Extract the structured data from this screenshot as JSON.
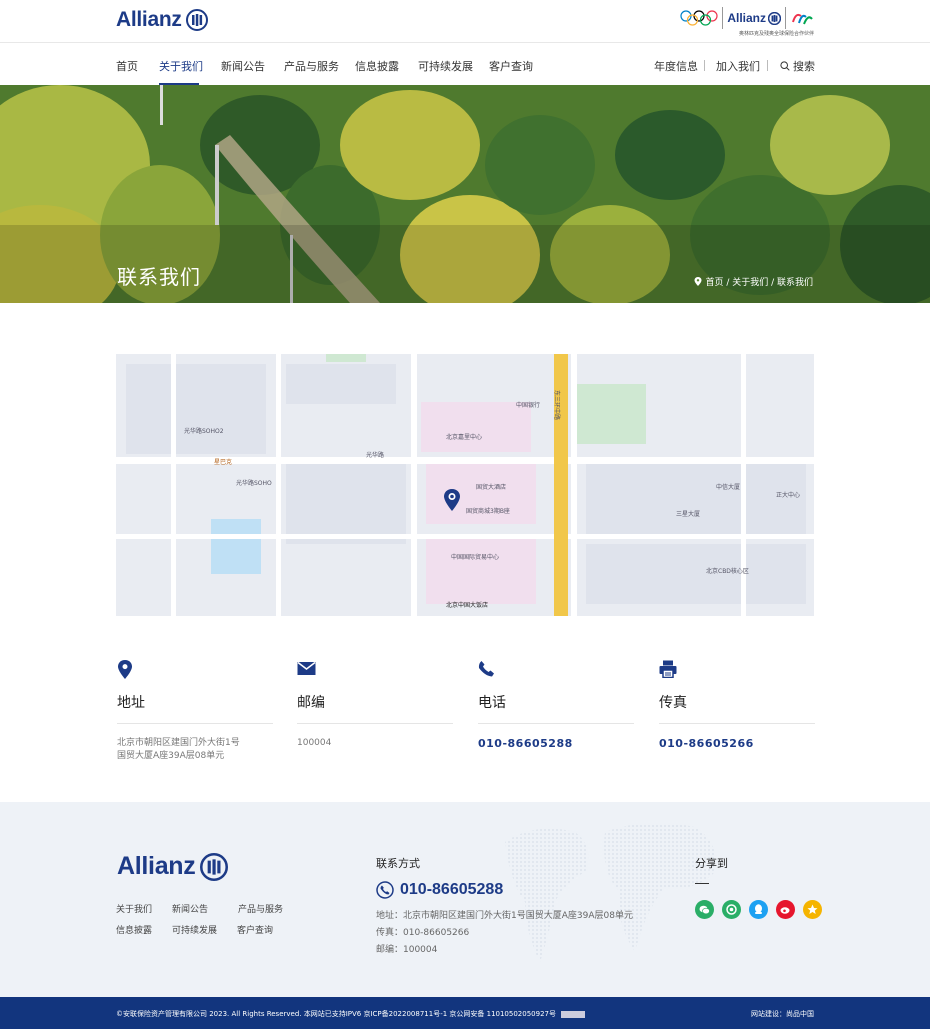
{
  "brand": {
    "name": "Allianz",
    "partner_name": "Allianz",
    "partner_text": "奥林匹克及残奥全球保险合作伙伴"
  },
  "nav": {
    "items": [
      {
        "label": "首页"
      },
      {
        "label": "关于我们",
        "active": true
      },
      {
        "label": "新闻公告"
      },
      {
        "label": "产品与服务"
      },
      {
        "label": "信息披露"
      },
      {
        "label": "可持续发展"
      },
      {
        "label": "客户查询"
      }
    ],
    "right": [
      {
        "label": "年度信息"
      },
      {
        "label": "加入我们"
      },
      {
        "label": "搜索"
      }
    ]
  },
  "banner": {
    "title": "联系我们",
    "breadcrumb": "首页 / 关于我们 / 联系我们"
  },
  "map": {
    "labels": [
      "光华路",
      "光华路SOHO",
      "北京嘉里中心",
      "国贸大酒店",
      "中国银行",
      "东三环中路",
      "光华路SOHO2",
      "星巴克",
      "北京中国大饭店",
      "正大中心",
      "中信大厦",
      "三星大厦",
      "北京CBD核心区",
      "国贸商城3期B座",
      "中国国际贸易中心"
    ]
  },
  "contact_cards": [
    {
      "icon": "location-icon",
      "title": "地址",
      "value_line1": "北京市朝阳区建国门外大街1号",
      "value_line2": "国贸大厦A座39A层08单元"
    },
    {
      "icon": "mail-icon",
      "title": "邮编",
      "value_line1": "100004",
      "value_line2": ""
    },
    {
      "icon": "phone-icon",
      "title": "电话",
      "value_line1": "010-86605288",
      "value_line2": ""
    },
    {
      "icon": "fax-icon",
      "title": "传真",
      "value_line1": "010-86605266",
      "value_line2": ""
    }
  ],
  "footer": {
    "logo_text": "Allianz",
    "links": [
      "关于我们",
      "新闻公告",
      "产品与服务",
      "信息披露",
      "可持续发展",
      "客户查询"
    ],
    "contact_heading": "联系方式",
    "phone": "010-86605288",
    "address": "地址：北京市朝阳区建国门外大街1号国贸大厦A座39A层08单元",
    "fax": "传真：010-86605266",
    "postcode": "邮编：100004",
    "share_heading": "分享到",
    "share_icons": [
      {
        "name": "wechat-icon",
        "color": "#2aae67"
      },
      {
        "name": "moments-icon",
        "color": "#2aae67"
      },
      {
        "name": "qq-icon",
        "color": "#1da1f2"
      },
      {
        "name": "weibo-icon",
        "color": "#e6162d"
      },
      {
        "name": "favorite-icon",
        "color": "#f5b400"
      }
    ]
  },
  "bottom": {
    "copyright": "©安联保险资产管理有限公司 2023. All Rights Reserved. 本网站已支持IPV6  京ICP备2022008711号-1  京公网安备 11010502050927号",
    "builder": "网站建设：尚品中国"
  },
  "colors": {
    "brand_blue": "#12357e",
    "footer_bg": "#eef2f7"
  }
}
